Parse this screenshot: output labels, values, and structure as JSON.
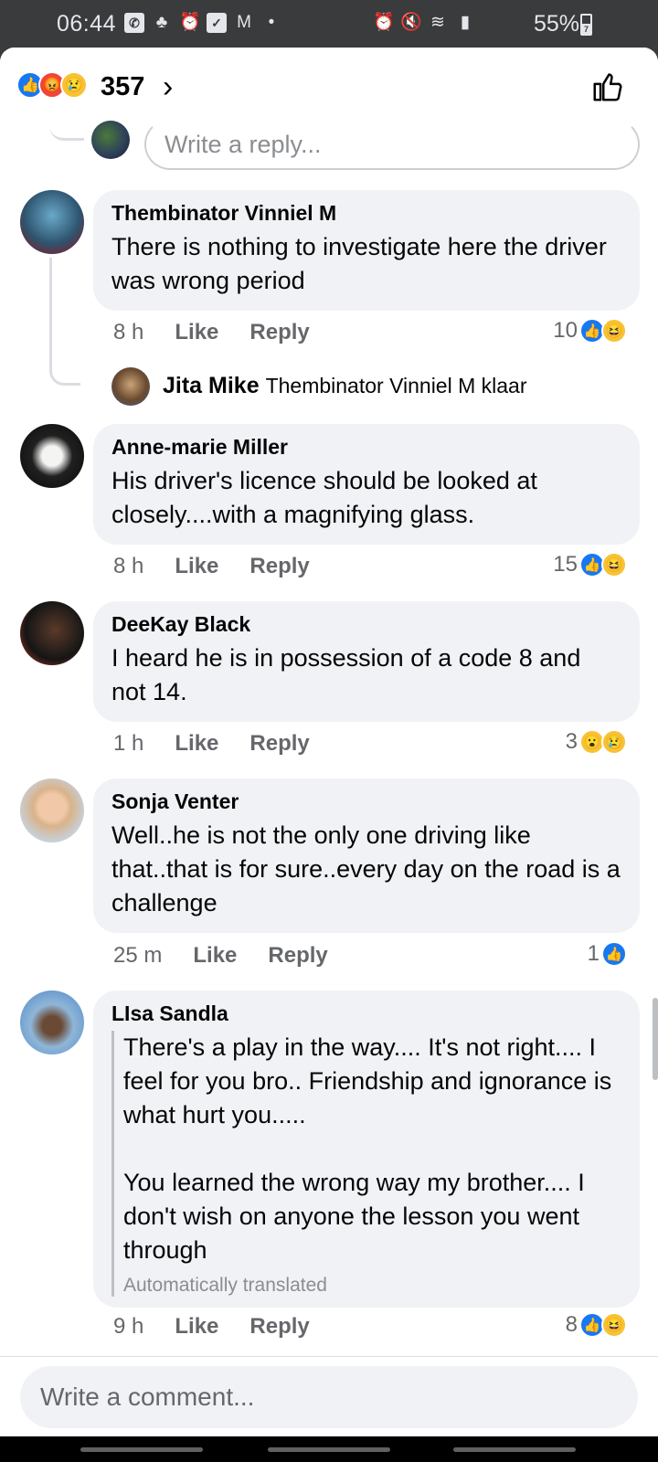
{
  "status_bar": {
    "time": "06:44",
    "battery": "55%",
    "battery_badge": "7",
    "left_icons": [
      "viber-icon",
      "silent-notification-icon",
      "alarm-icon",
      "checkbox-icon",
      "gmail-icon",
      "dot-icon"
    ],
    "right_icons": [
      "alarm-icon",
      "mute-icon",
      "wifi-icon",
      "signal-icon"
    ]
  },
  "header": {
    "reaction_count": "357",
    "reactions": [
      "like",
      "angry",
      "sad"
    ]
  },
  "reply_box": {
    "placeholder": "Write a reply..."
  },
  "comments": [
    {
      "author": "Thembinator Vinniel M",
      "text": "There is nothing to investigate here the driver was wrong period",
      "time": "8 h",
      "like_label": "Like",
      "reply_label": "Reply",
      "reaction_count": "10",
      "reactions": [
        "like",
        "haha"
      ]
    },
    {
      "author": "Anne-marie Miller",
      "text": "His driver's licence should be looked at closely....with a magnifying glass.",
      "time": "8 h",
      "like_label": "Like",
      "reply_label": "Reply",
      "reaction_count": "15",
      "reactions": [
        "like",
        "haha"
      ]
    },
    {
      "author": "DeeKay Black",
      "text": "I heard he is in possession of a code 8 and not 14.",
      "time": "1 h",
      "like_label": "Like",
      "reply_label": "Reply",
      "reaction_count": "3",
      "reactions": [
        "wow",
        "sad"
      ]
    },
    {
      "author": "Sonja Venter",
      "text": "Well..he is not the only one driving like that..that is for sure..every day on the road is a challenge",
      "time": "25 m",
      "like_label": "Like",
      "reply_label": "Reply",
      "reaction_count": "1",
      "reactions": [
        "like"
      ]
    },
    {
      "author": "LIsa Sandla",
      "text": "There's a play in the way.... It's not right.... I feel for you bro.. Friendship and ignorance is what hurt you.....\n\nYou learned the wrong way my brother.... I don't wish on anyone the lesson you went through",
      "translated_note": "Automatically translated",
      "time": "9 h",
      "like_label": "Like",
      "reply_label": "Reply",
      "reaction_count": "8",
      "reactions": [
        "like",
        "haha"
      ]
    }
  ],
  "reply_preview": {
    "author": "Jita Mike",
    "text": "Thembinator Vinniel M klaar"
  },
  "comment_bar": {
    "placeholder": "Write a comment..."
  }
}
